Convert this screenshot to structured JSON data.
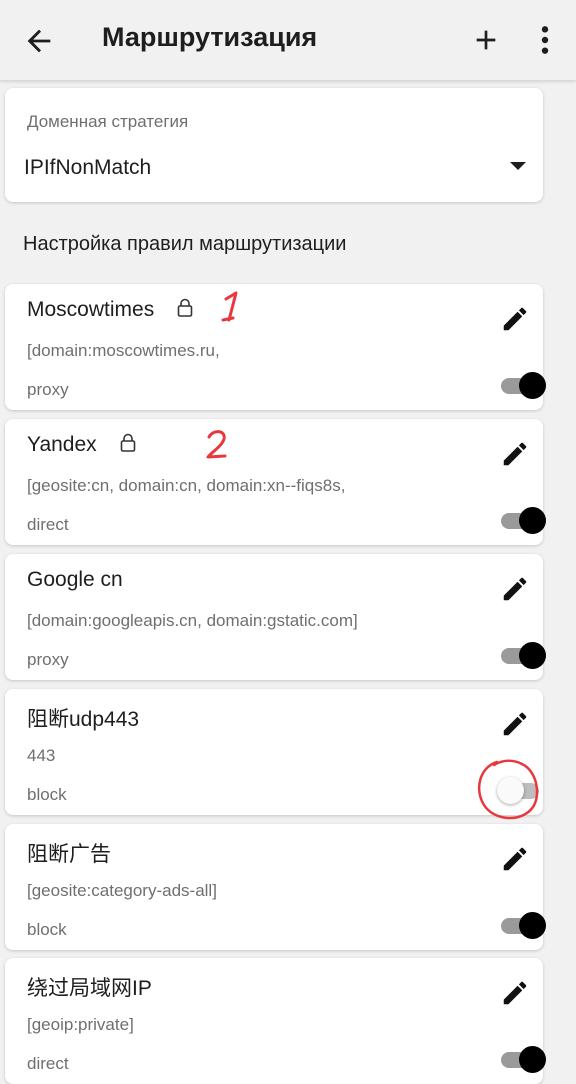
{
  "header": {
    "title": "Маршрутизация",
    "back_icon": "arrow-back-icon",
    "add_icon": "plus-icon",
    "more_icon": "more-vert-icon"
  },
  "domain_strategy": {
    "label": "Доменная стратегия",
    "value": "IPIfNonMatch"
  },
  "section_title": "Настройка правил маршрутизации",
  "rules": [
    {
      "name": "Moscowtimes",
      "locked": true,
      "domains": "[domain:moscowtimes.ru,",
      "outbound": "proxy",
      "enabled": true,
      "annotation": "1"
    },
    {
      "name": "Yandex",
      "locked": true,
      "domains": "[geosite:cn, domain:cn, domain:xn--fiqs8s,",
      "outbound": "direct",
      "enabled": true,
      "annotation": "2"
    },
    {
      "name": "Google cn",
      "locked": false,
      "domains": "[domain:googleapis.cn, domain:gstatic.com]",
      "outbound": "proxy",
      "enabled": true
    },
    {
      "name": "阻断udp443",
      "locked": false,
      "domains": "443",
      "outbound": "block",
      "enabled": false,
      "circled": true
    },
    {
      "name": "阻断广告",
      "locked": false,
      "domains": "[geosite:category-ads-all]",
      "outbound": "block",
      "enabled": true
    },
    {
      "name": "绕过局域网IP",
      "locked": false,
      "domains": "[geoip:private]",
      "outbound": "direct",
      "enabled": true
    }
  ],
  "colors": {
    "background": "#f1f1f1",
    "card": "#ffffff",
    "toggle_on_thumb": "#000000",
    "annotation_red": "#e8383d"
  }
}
